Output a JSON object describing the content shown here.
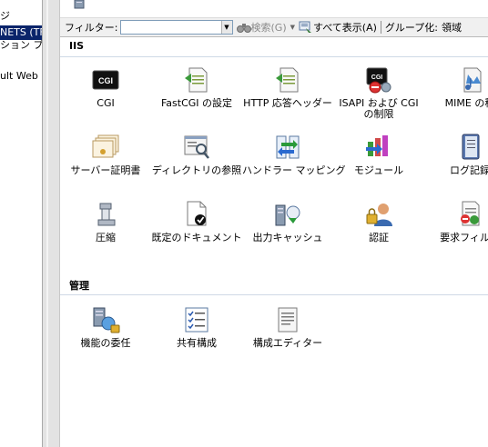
{
  "tree": {
    "items": [
      {
        "label": "ジ"
      },
      {
        "label": "NETS (TF"
      },
      {
        "label": "ション プ"
      },
      {
        "label": "ult Web S"
      }
    ]
  },
  "toolbar": {
    "filter_label": "フィルター:",
    "search_label": "検索(G)",
    "show_all_label": "すべて表示(A)",
    "group_by_label": "グループ化:",
    "group_by_value": "領域"
  },
  "sections": {
    "iis": {
      "title": "IIS"
    },
    "manage": {
      "title": "管理"
    }
  },
  "features": {
    "cgi": "CGI",
    "fastcgi": "FastCGI の設定",
    "http_headers": "HTTP 応答ヘッダー",
    "isapi_line1": "ISAPI および CGI",
    "isapi_line2": "の制限",
    "mime": "MIME の種",
    "server_cert": "サーバー証明書",
    "dir_browse": "ディレクトリの参照",
    "handler": "ハンドラー マッピング",
    "modules": "モジュール",
    "logging": "ログ記録",
    "compression": "圧縮",
    "default_doc": "既定のドキュメント",
    "output_cache": "出力キャッシュ",
    "auth": "認証",
    "request_filter": "要求フィルタ",
    "delegation": "機能の委任",
    "shared_config": "共有構成",
    "config_editor": "構成エディター"
  },
  "icons": {
    "cgi_icon_text": "CGI"
  },
  "colors": {
    "selection": "#0a246a",
    "toolbar_bg": "#f0f0f0"
  }
}
